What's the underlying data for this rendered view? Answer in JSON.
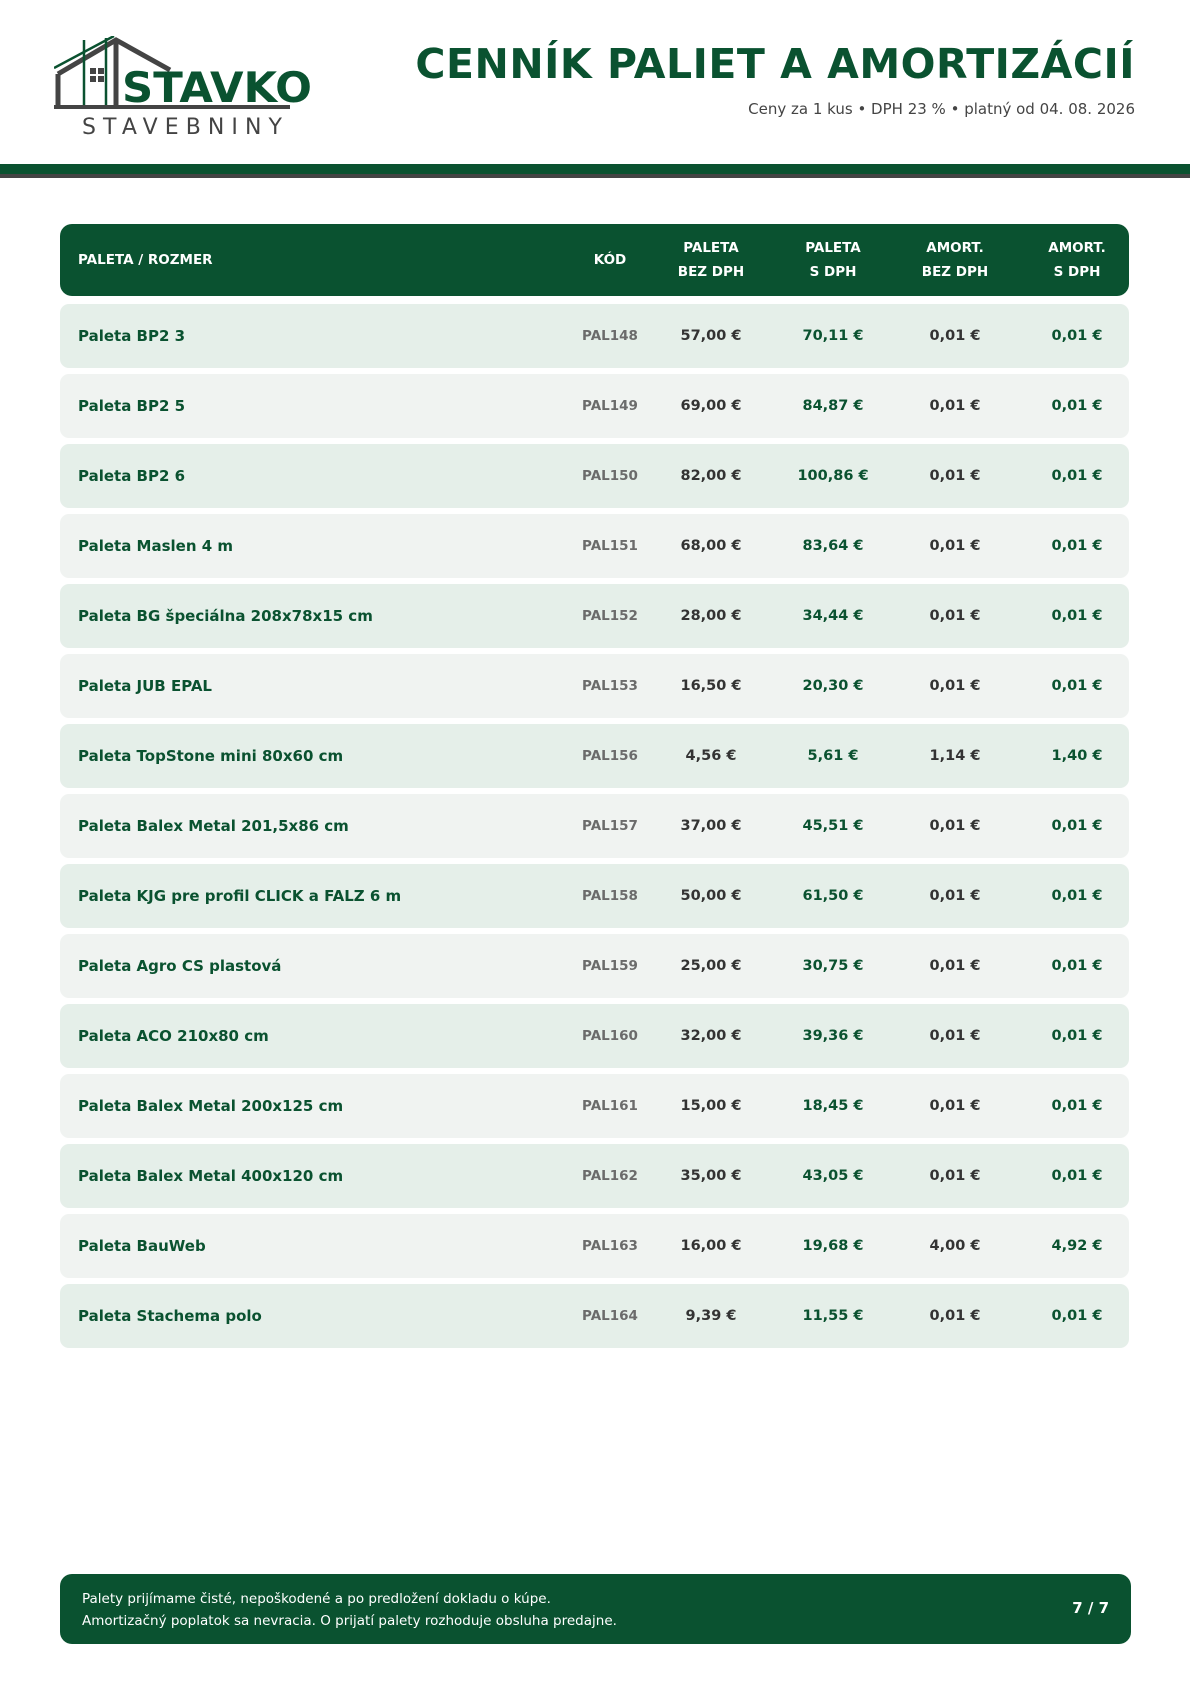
{
  "brand": {
    "name": "STAVKO",
    "tagline": "STAVEBNINY"
  },
  "header": {
    "title": "CENNÍK PALIET A AMORTIZÁCIÍ",
    "subtitle": "Ceny za 1 kus • DPH 23 % • platný od 04. 08. 2026"
  },
  "colors": {
    "primary": "#0a5230",
    "dark": "#444444",
    "row_odd": "#e5efe9",
    "row_even": "#f0f3f1"
  },
  "table": {
    "headers": {
      "name": "PALETA / ROZMER",
      "code": "KÓD",
      "p1_a": "PALETA",
      "p1_b": "BEZ DPH",
      "p2_a": "PALETA",
      "p2_b": "S DPH",
      "a1_a": "AMORT.",
      "a1_b": "BEZ DPH",
      "a2_a": "AMORT.",
      "a2_b": "S DPH"
    },
    "rows": [
      {
        "name": "Paleta BP2 3",
        "code": "PAL148",
        "p1": "57,00 €",
        "p2": "70,11 €",
        "a1": "0,01 €",
        "a2": "0,01 €"
      },
      {
        "name": "Paleta BP2 5",
        "code": "PAL149",
        "p1": "69,00 €",
        "p2": "84,87 €",
        "a1": "0,01 €",
        "a2": "0,01 €"
      },
      {
        "name": "Paleta BP2 6",
        "code": "PAL150",
        "p1": "82,00 €",
        "p2": "100,86 €",
        "a1": "0,01 €",
        "a2": "0,01 €"
      },
      {
        "name": "Paleta Maslen 4 m",
        "code": "PAL151",
        "p1": "68,00 €",
        "p2": "83,64 €",
        "a1": "0,01 €",
        "a2": "0,01 €"
      },
      {
        "name": "Paleta BG špeciálna 208x78x15 cm",
        "code": "PAL152",
        "p1": "28,00 €",
        "p2": "34,44 €",
        "a1": "0,01 €",
        "a2": "0,01 €"
      },
      {
        "name": "Paleta JUB EPAL",
        "code": "PAL153",
        "p1": "16,50 €",
        "p2": "20,30 €",
        "a1": "0,01 €",
        "a2": "0,01 €"
      },
      {
        "name": "Paleta TopStone mini 80x60 cm",
        "code": "PAL156",
        "p1": "4,56 €",
        "p2": "5,61 €",
        "a1": "1,14 €",
        "a2": "1,40 €"
      },
      {
        "name": "Paleta Balex Metal 201,5x86 cm",
        "code": "PAL157",
        "p1": "37,00 €",
        "p2": "45,51 €",
        "a1": "0,01 €",
        "a2": "0,01 €"
      },
      {
        "name": "Paleta KJG pre profil CLICK a FALZ 6 m",
        "code": "PAL158",
        "p1": "50,00 €",
        "p2": "61,50 €",
        "a1": "0,01 €",
        "a2": "0,01 €"
      },
      {
        "name": "Paleta Agro CS plastová",
        "code": "PAL159",
        "p1": "25,00 €",
        "p2": "30,75 €",
        "a1": "0,01 €",
        "a2": "0,01 €"
      },
      {
        "name": "Paleta ACO 210x80 cm",
        "code": "PAL160",
        "p1": "32,00 €",
        "p2": "39,36 €",
        "a1": "0,01 €",
        "a2": "0,01 €"
      },
      {
        "name": "Paleta Balex Metal 200x125 cm",
        "code": "PAL161",
        "p1": "15,00 €",
        "p2": "18,45 €",
        "a1": "0,01 €",
        "a2": "0,01 €"
      },
      {
        "name": "Paleta Balex Metal 400x120 cm",
        "code": "PAL162",
        "p1": "35,00 €",
        "p2": "43,05 €",
        "a1": "0,01 €",
        "a2": "0,01 €"
      },
      {
        "name": "Paleta BauWeb",
        "code": "PAL163",
        "p1": "16,00 €",
        "p2": "19,68 €",
        "a1": "4,00 €",
        "a2": "4,92 €"
      },
      {
        "name": "Paleta Stachema polo",
        "code": "PAL164",
        "p1": "9,39 €",
        "p2": "11,55 €",
        "a1": "0,01 €",
        "a2": "0,01 €"
      }
    ]
  },
  "footer": {
    "line1": "Palety prijímame čisté, nepoškodené a po predložení dokladu o kúpe.",
    "line2": "Amortizačný poplatok sa nevracia. O prijatí palety rozhoduje obsluha predajne.",
    "page": "7 / 7"
  }
}
